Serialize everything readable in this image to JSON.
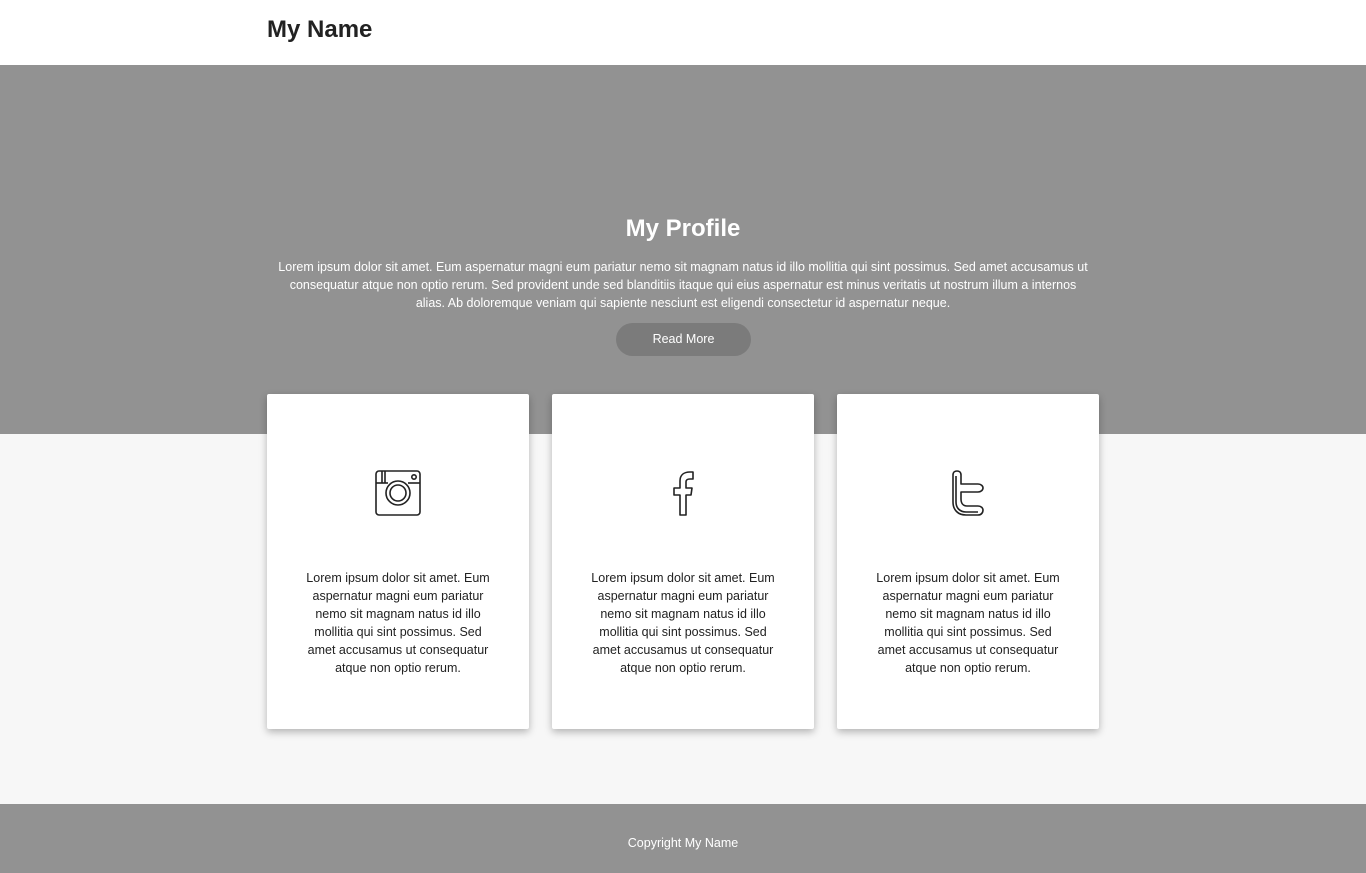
{
  "header": {
    "brand": "My Name"
  },
  "hero": {
    "title": "My Profile",
    "text": "Lorem ipsum dolor sit amet. Eum aspernatur magni eum pariatur nemo sit magnam natus id illo mollitia qui sint possimus. Sed amet accusamus ut consequatur atque non optio rerum. Sed provident unde sed blanditiis itaque qui eius aspernatur est minus veritatis ut nostrum illum a internos alias. Ab doloremque veniam qui sapiente nesciunt est eligendi consectetur id aspernatur neque.",
    "button_label": "Read More",
    "background": "#929292"
  },
  "cards": [
    {
      "icon": "instagram-icon",
      "text": "Lorem ipsum dolor sit amet. Eum aspernatur magni eum pariatur nemo sit magnam natus id illo mollitia qui sint possimus. Sed amet accusamus ut consequatur atque non optio rerum."
    },
    {
      "icon": "facebook-icon",
      "text": "Lorem ipsum dolor sit amet. Eum aspernatur magni eum pariatur nemo sit magnam natus id illo mollitia qui sint possimus. Sed amet accusamus ut consequatur atque non optio rerum."
    },
    {
      "icon": "twitter-icon",
      "text": "Lorem ipsum dolor sit amet. Eum aspernatur magni eum pariatur nemo sit magnam natus id illo mollitia qui sint possimus. Sed amet accusamus ut consequatur atque non optio rerum."
    }
  ],
  "footer": {
    "text": "Copyright My Name"
  }
}
